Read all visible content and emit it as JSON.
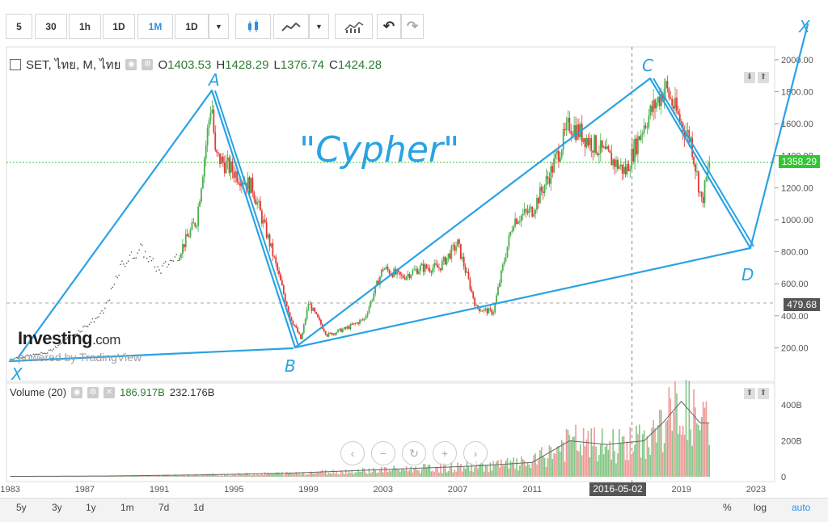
{
  "toolbar": {
    "intervals": [
      "5",
      "30",
      "1h",
      "1D",
      "1M",
      "1D"
    ],
    "active": "1M"
  },
  "legend": {
    "symbol": "SET, ไทย, M, ไทย",
    "o_label": "O",
    "o": "1403.53",
    "h_label": "H",
    "h": "1428.29",
    "l_label": "L",
    "l": "1376.74",
    "c_label": "C",
    "c": "1424.28"
  },
  "volume_legend": {
    "label": "Volume (20)",
    "v1": "186.917B",
    "v2": "232.176B"
  },
  "brand": {
    "name": "Investing",
    "suffix": ".com",
    "powered": "powered by TradingView"
  },
  "price_tags": {
    "current": "1358.29",
    "crosshair": "479.68"
  },
  "date_tag": "2016-05-02",
  "bottom": {
    "ranges": [
      "5y",
      "3y",
      "1y",
      "1m",
      "7d",
      "1d"
    ],
    "percent": "%",
    "log": "log",
    "auto": "auto"
  },
  "annotations": {
    "pattern": "\"Cypher\"",
    "x_left": "X",
    "a": "A",
    "b": "B",
    "c": "C",
    "d": "D",
    "x_right": "X"
  },
  "colors": {
    "up": "#4caf50",
    "down": "#e53935",
    "drawing": "#29a3e3",
    "current_line": "#31c731"
  },
  "chart_data": {
    "type": "line",
    "title": "",
    "x_ticks": [
      "1983",
      "1987",
      "1991",
      "1995",
      "1999",
      "2003",
      "2007",
      "2011",
      "2015",
      "2019",
      "2023"
    ],
    "y_ticks": [
      "2000.00",
      "1800.00",
      "1600.00",
      "1400.00",
      "1200.00",
      "1000.00",
      "800.00",
      "600.00",
      "400.00",
      "200.00"
    ],
    "ylim": [
      0,
      2000
    ],
    "volume_ticks": [
      "400B",
      "200B",
      "0"
    ],
    "series": [
      {
        "x": [
          1983,
          1985,
          1987,
          1988,
          1989,
          1990,
          1991,
          1992,
          1993,
          1993.8,
          1994,
          1995,
          1996,
          1997,
          1998,
          1998.6,
          1999,
          2000,
          2001,
          2002,
          2003,
          2004,
          2005,
          2006,
          2007,
          2008,
          2008.9,
          2009.5,
          2010,
          2011,
          2012,
          2013,
          2014,
          2015,
          2016,
          2017,
          2018,
          2018.1,
          2019,
          2019.5,
          2020.1,
          2020.5
        ],
        "y": [
          130,
          170,
          330,
          420,
          720,
          820,
          680,
          780,
          1000,
          1753,
          1400,
          1300,
          1200,
          820,
          400,
          250,
          480,
          280,
          320,
          380,
          700,
          640,
          700,
          700,
          850,
          450,
          420,
          750,
          1000,
          1060,
          1300,
          1600,
          1500,
          1400,
          1300,
          1600,
          1800,
          1838,
          1600,
          1500,
          1100,
          1358
        ]
      }
    ],
    "volume": {
      "x": [
        1983,
        1988,
        1993,
        1998,
        2003,
        2008,
        2011,
        2013,
        2015,
        2017,
        2018,
        2019,
        2020
      ],
      "values": [
        2,
        4,
        10,
        20,
        40,
        60,
        80,
        200,
        180,
        200,
        300,
        420,
        300
      ]
    }
  }
}
